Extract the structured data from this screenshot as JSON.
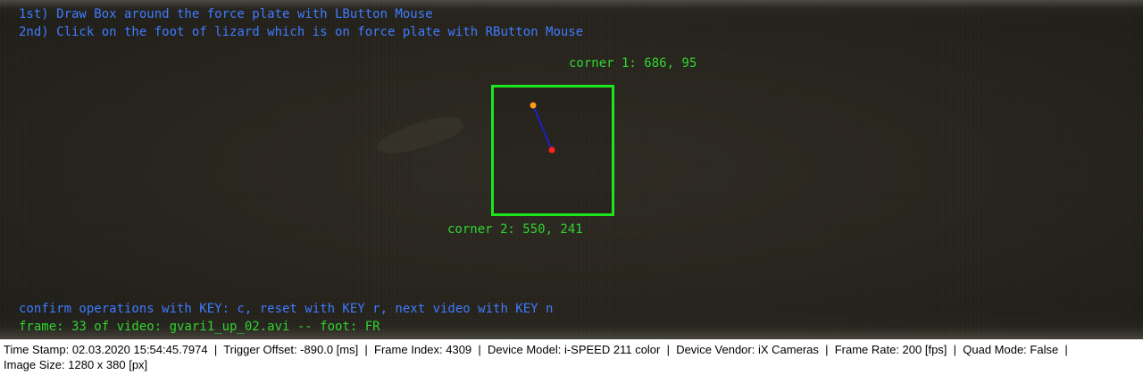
{
  "overlay": {
    "instruction_1": "1st) Draw Box around the force plate with LButton Mouse",
    "instruction_2": "2nd) Click on the foot of lizard which is on force plate with RButton Mouse",
    "corner_1_label": "corner 1: 686, 95",
    "corner_2_label": "corner 2: 550, 241",
    "confirm_text": "confirm operations with KEY: c, reset with KEY r, next video with KEY n",
    "frame_text": "frame: 33 of video: gvari1_up_02.avi -- foot: FR",
    "colors": {
      "instruction_text": "#3f7bff",
      "status_text": "#2fd52f",
      "box": "#1ee61e",
      "point_orange": "#ff9a1a",
      "point_red": "#ff2020",
      "line": "#1a22c8"
    }
  },
  "statusbar": {
    "line_1": "Time Stamp: 02.03.2020 15:54:45.7974  |  Trigger Offset: -890.0 [ms]  |  Frame Index: 4309  |  Device Model: i-SPEED 211 color  |  Device Vendor: iX Cameras  |  Frame Rate: 200 [fps]  |  Quad Mode: False  |",
    "line_2": "Image Size: 1280 x 380 [px]"
  }
}
